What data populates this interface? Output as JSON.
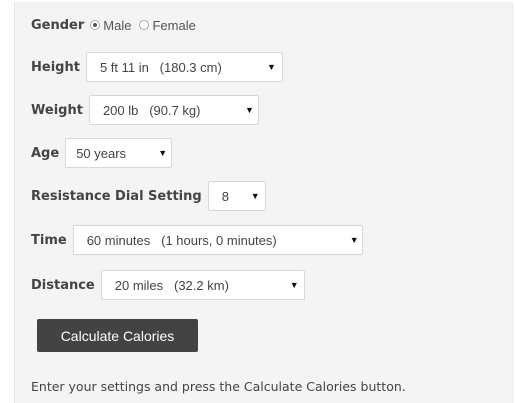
{
  "form": {
    "gender": {
      "label": "Gender",
      "options": [
        "Male",
        "Female"
      ],
      "selected": "Male"
    },
    "height": {
      "label": "Height",
      "value": "5 ft 11 in   (180.3 cm)"
    },
    "weight": {
      "label": "Weight",
      "value": "200 lb   (90.7 kg)"
    },
    "age": {
      "label": "Age",
      "value": "50 years"
    },
    "resistance": {
      "label": "Resistance Dial Setting",
      "value": "8"
    },
    "time": {
      "label": "Time",
      "value": "60 minutes   (1 hours, 0 minutes)"
    },
    "distance": {
      "label": "Distance",
      "value": "20 miles   (32.2 km)"
    }
  },
  "calculate_button": {
    "label": "Calculate Calories"
  },
  "instructions": "Enter your settings and press the Calculate Calories button.",
  "colors": {
    "panel_background": "#f4f4f4",
    "button_background": "#434343",
    "button_text": "#ffffff",
    "label_text": "#444444"
  },
  "icons": {
    "dropdown": "caret-down-icon",
    "radio_selected": "radio-selected-icon",
    "radio_unselected": "radio-unselected-icon"
  }
}
